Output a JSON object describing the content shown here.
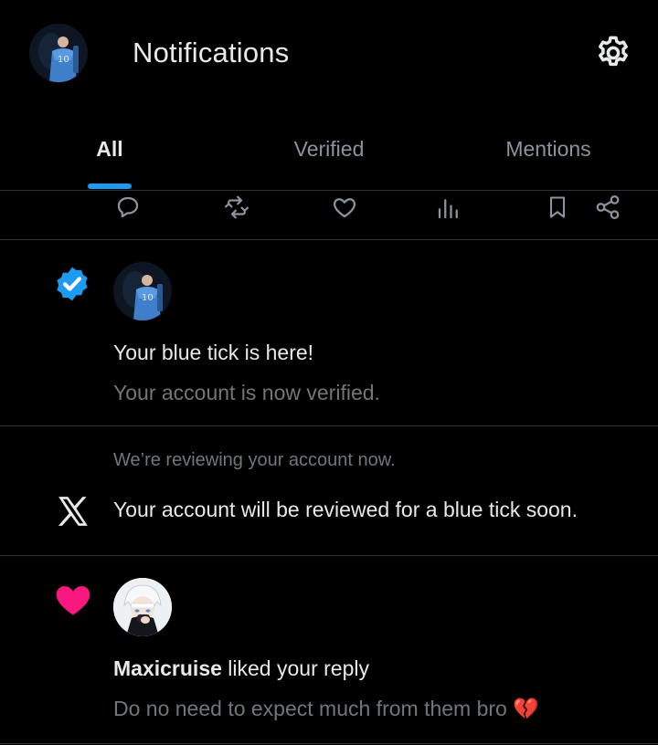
{
  "header": {
    "title": "Notifications",
    "avatar_icon": "profile-avatar-player-10",
    "settings_icon": "gear-icon"
  },
  "tabs": [
    {
      "label": "All",
      "active": true
    },
    {
      "label": "Verified",
      "active": false
    },
    {
      "label": "Mentions",
      "active": false
    }
  ],
  "action_bar": [
    "reply-icon",
    "repost-icon",
    "like-icon",
    "views-icon",
    "bookmark-icon",
    "share-icon"
  ],
  "notifications": [
    {
      "type": "verified",
      "icon": "verified-badge-icon",
      "title": "Your blue tick is here!",
      "body": "Your account is now verified."
    },
    {
      "type": "review",
      "icon": "x-logo-icon",
      "pre": "We’re reviewing your account now.",
      "title": "Your account will be reviewed for a blue tick soon."
    },
    {
      "type": "like",
      "icon": "heart-icon",
      "user": "Maxicruise",
      "action": "liked your reply",
      "body": "Do no need to expect much from them bro",
      "emoji": "💔"
    }
  ],
  "colors": {
    "accent": "#1d9bf0",
    "like": "#f91880",
    "text": "#e7e9ea",
    "muted": "#71767b",
    "divider": "#2f3336"
  }
}
